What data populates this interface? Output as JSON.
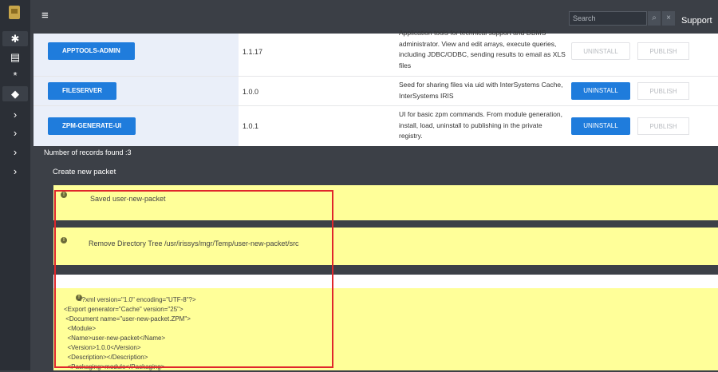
{
  "topbar": {
    "search_placeholder": "Search",
    "search_icon": "magnifier-icon",
    "close_icon": "close-icon",
    "support_label": "Support"
  },
  "sidebar": {
    "items": [
      "gear-icon",
      "table-icon",
      "asterisk-icon",
      "package-icon",
      "chevron-right-icon",
      "chevron-right-icon",
      "chevron-right-icon",
      "chevron-right-icon"
    ]
  },
  "packages": [
    {
      "name": "APPTOOLS-ADMIN",
      "version": "1.1.17",
      "description": "Application tools for technical support and DBMS administrator. View and edit arrays, execute queries, including JDBC/ODBC, sending results to email as XLS files",
      "uninstall": "UNINSTALL",
      "publish": "PUBLISH"
    },
    {
      "name": "FILESERVER",
      "version": "1.0.0",
      "description": "Seed for sharing files via uid with InterSystems Cache, InterSystems IRIS",
      "uninstall": "UNINSTALL",
      "publish": "PUBLISH"
    },
    {
      "name": "ZPM-GENERATE-UI",
      "version": "1.0.1",
      "description": "UI for basic zpm commands. From module generation, install, load, uninstall to publishing in the private registry.",
      "uninstall": "UNINSTALL",
      "publish": "PUBLISH"
    }
  ],
  "records_found": "Number of records found :3",
  "create_new": "Create new packet",
  "alerts": [
    {
      "text": "Saved user-new-packet"
    },
    {
      "text": "Remove Directory Tree /usr/irissys/mgr/Temp/user-new-packet/src"
    }
  ],
  "xml_lines": [
    "        <?xml version=\"1.0\" encoding=\"UTF-8\"?>",
    "<Export generator=\"Cache\" version=\"25\">",
    " <Document name=\"user-new-packet.ZPM\">",
    "  <Module>",
    "  <Name>user-new-packet</Name>",
    "  <Version>1.0.0</Version>",
    "  <Description></Description>",
    "  <Packaging>module</Packaging>"
  ]
}
